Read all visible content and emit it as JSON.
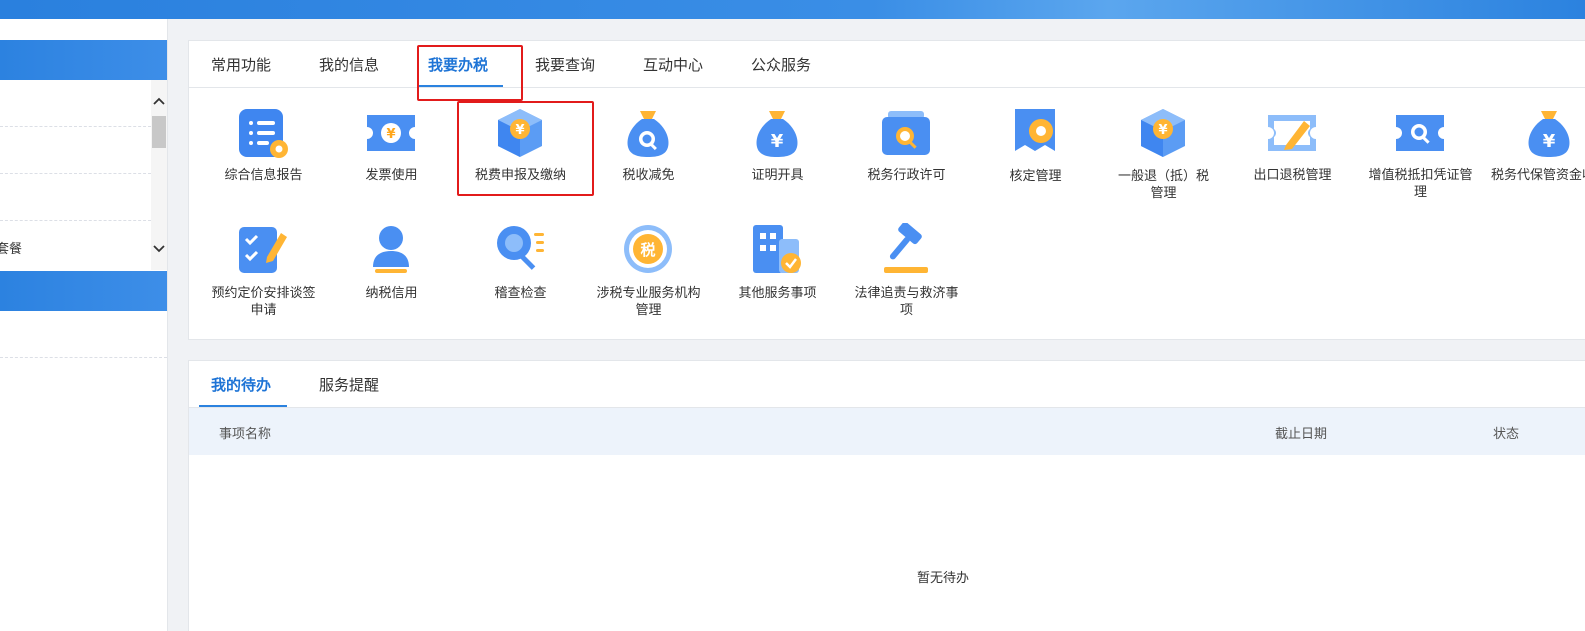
{
  "colors": {
    "accent": "#2b82df",
    "active_tab": "#1e74d6",
    "highlight": "#e21b1b",
    "table_head_bg": "#edf3fb"
  },
  "sidebar": {
    "rows": [
      "",
      "",
      "",
      "套餐"
    ],
    "scroll_up_icon": "chevron-up-icon",
    "scroll_down_icon": "chevron-down-icon"
  },
  "tabs": [
    {
      "label": "常用功能",
      "active": false
    },
    {
      "label": "我的信息",
      "active": false
    },
    {
      "label": "我要办税",
      "active": true
    },
    {
      "label": "我要查询",
      "active": false
    },
    {
      "label": "互动中心",
      "active": false
    },
    {
      "label": "公众服务",
      "active": false
    }
  ],
  "functions": [
    {
      "label": "综合信息报告",
      "icon": "document-list-icon"
    },
    {
      "label": "发票使用",
      "icon": "invoice-ticket-icon"
    },
    {
      "label": "税费申报及缴纳",
      "icon": "yuan-cube-icon"
    },
    {
      "label": "税收减免",
      "icon": "money-bag-search-icon"
    },
    {
      "label": "证明开具",
      "icon": "money-bag-yuan-icon"
    },
    {
      "label": "税务行政许可",
      "icon": "folder-search-icon"
    },
    {
      "label": "核定管理",
      "icon": "badge-gear-icon"
    },
    {
      "label": "一般退（抵）税管理",
      "icon": "yuan-cube-icon"
    },
    {
      "label": "出口退税管理",
      "icon": "ticket-edit-icon"
    },
    {
      "label": "增值税抵扣凭证管理",
      "icon": "ticket-search-icon"
    },
    {
      "label": "税务代保管资金收取",
      "icon": "money-bag-yuan-icon"
    },
    {
      "label": "预约定价安排谈签申请",
      "icon": "checklist-pen-icon"
    },
    {
      "label": "纳税信用",
      "icon": "user-icon"
    },
    {
      "label": "稽查检查",
      "icon": "magnifier-list-icon"
    },
    {
      "label": "涉税专业服务机构管理",
      "icon": "tax-seal-icon"
    },
    {
      "label": "其他服务事项",
      "icon": "building-check-icon"
    },
    {
      "label": "法律追责与救济事项",
      "icon": "gavel-icon"
    }
  ],
  "todo": {
    "tabs": [
      {
        "label": "我的待办",
        "active": true
      },
      {
        "label": "服务提醒",
        "active": false
      }
    ],
    "columns": [
      "事项名称",
      "截止日期",
      "状态"
    ],
    "empty_text": "暂无待办"
  }
}
